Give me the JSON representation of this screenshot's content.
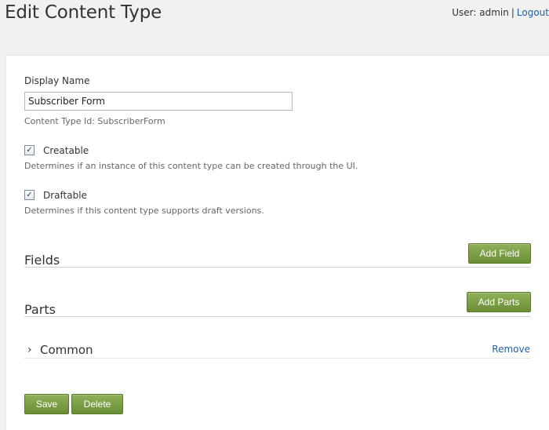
{
  "header": {
    "title": "Edit Content Type",
    "user_label": "User: admin",
    "separator": "|",
    "logout_label": "Logout"
  },
  "form": {
    "display_name_label": "Display Name",
    "display_name_value": "Subscriber Form",
    "content_type_id": "Content Type Id: SubscriberForm",
    "creatable": {
      "checked": true,
      "label": "Creatable",
      "hint": "Determines if an instance of this content type can be created through the UI."
    },
    "draftable": {
      "checked": true,
      "label": "Draftable",
      "hint": "Determines if this content type supports draft versions."
    }
  },
  "fields_section": {
    "title": "Fields",
    "add_label": "Add Field"
  },
  "parts_section": {
    "title": "Parts",
    "add_label": "Add Parts",
    "items": [
      {
        "name": "Common",
        "remove_label": "Remove"
      }
    ]
  },
  "actions": {
    "save_label": "Save",
    "delete_label": "Delete"
  },
  "colors": {
    "button_green": "#7a9e45",
    "link_blue": "#1e5fa8"
  }
}
